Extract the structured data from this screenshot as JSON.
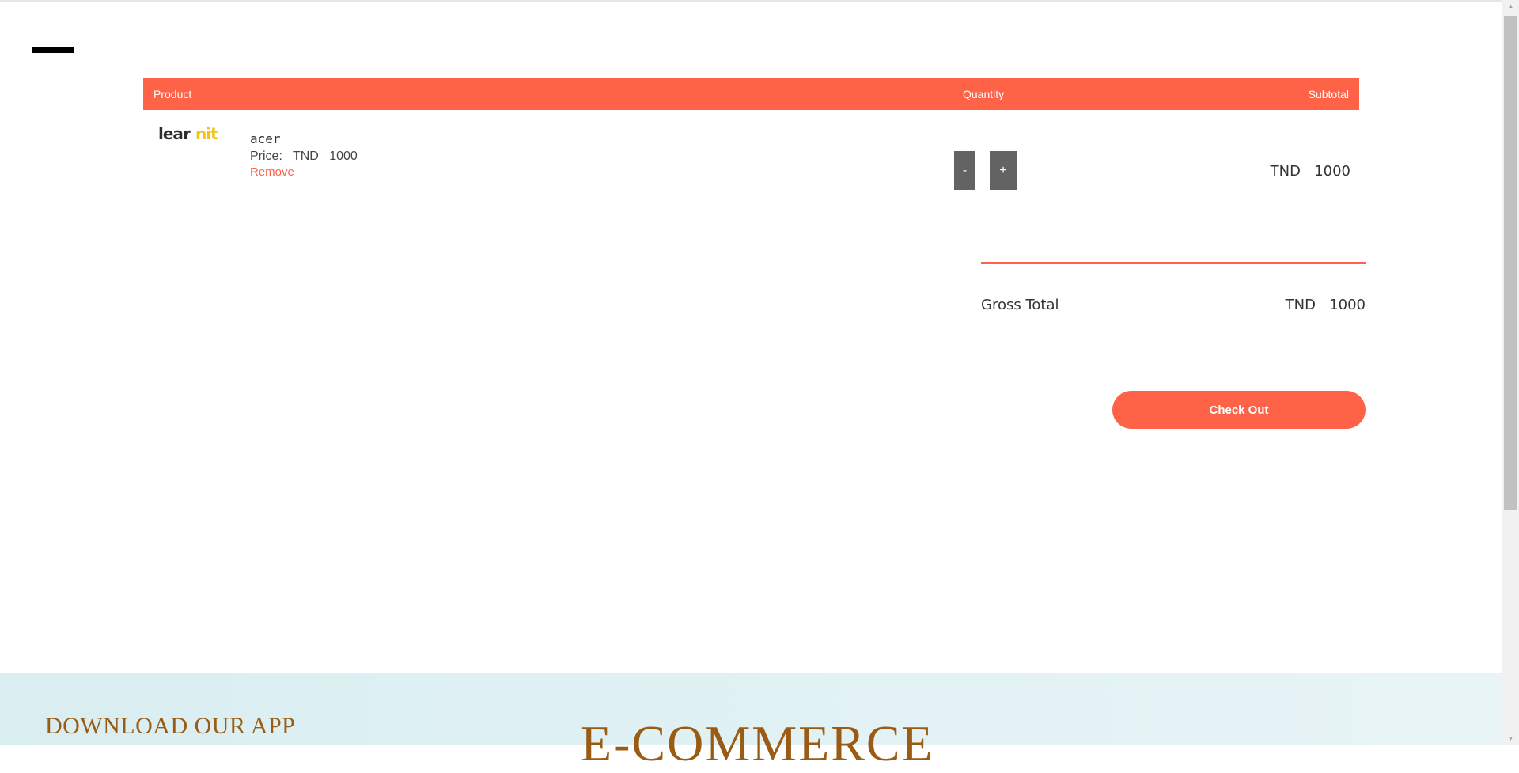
{
  "header": {
    "menu_icon": "hamburger-menu-icon"
  },
  "cart": {
    "columns": {
      "product": "Product",
      "quantity": "Quantity",
      "subtotal": "Subtotal"
    },
    "items": [
      {
        "logo_text": "learnit",
        "name": "acer",
        "price_label": "Price:",
        "currency": "TND",
        "price": "1000",
        "remove_label": "Remove",
        "minus_label": "-",
        "plus_label": "+",
        "subtotal": "1000"
      }
    ]
  },
  "summary": {
    "gross_label": "Gross Total",
    "currency": "TND",
    "gross_value": "1000",
    "checkout_label": "Check Out"
  },
  "footer": {
    "download_label": "DOWNLOAD OUR APP",
    "brand": "E-COMMERCE"
  },
  "colors": {
    "accent": "#ff6347",
    "qty_button": "#636363",
    "footer_text": "#9a5b14",
    "footer_bg": "#d9eef1"
  }
}
